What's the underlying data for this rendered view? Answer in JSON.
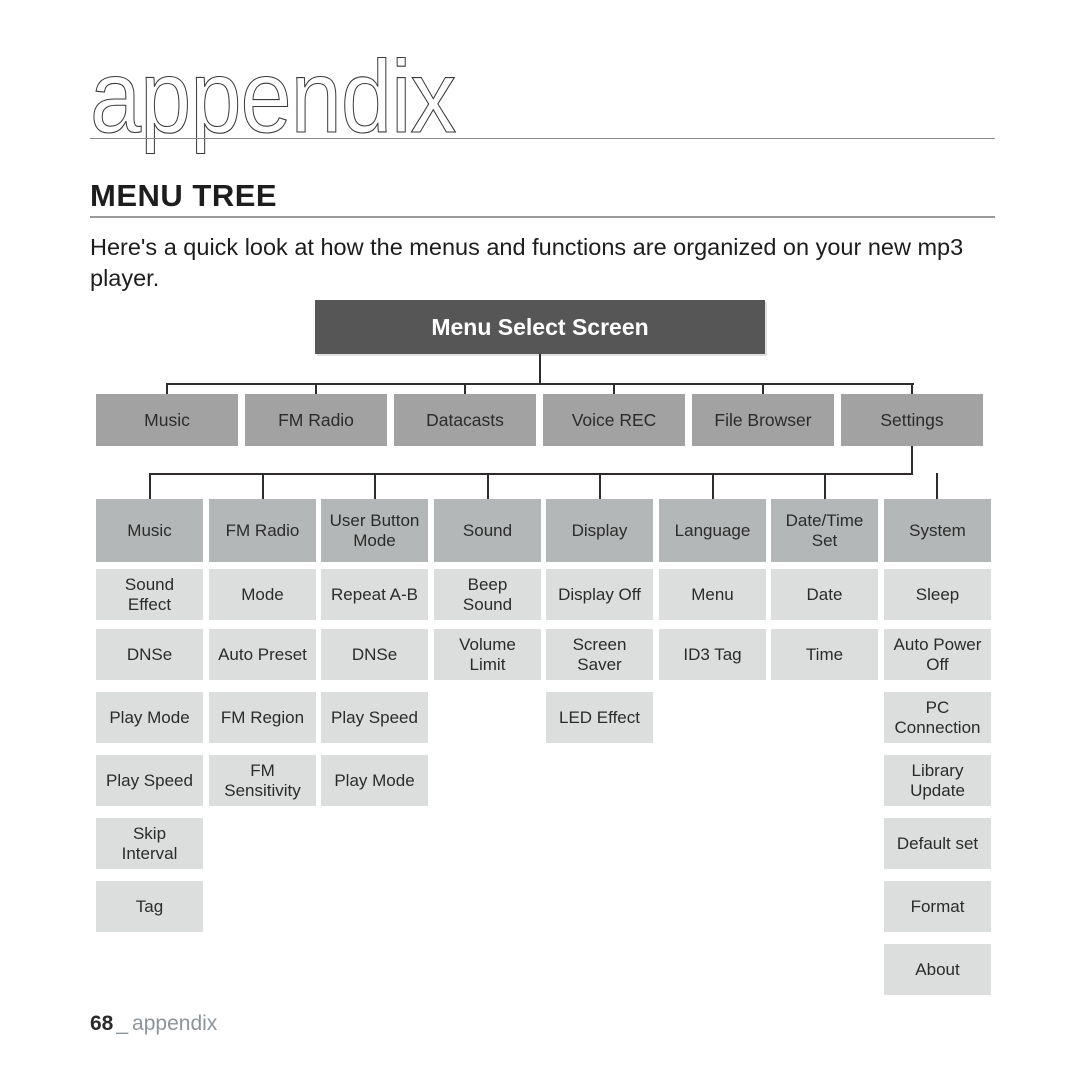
{
  "header": {
    "wordmark": "appendix",
    "section_title": "MENU TREE",
    "intro": "Here's a quick look at how the menus and functions are organized on your new mp3 player."
  },
  "footer": {
    "page_number": "68",
    "separator": "_",
    "label": "appendix"
  },
  "colors": {
    "root_box": "#565656",
    "level1_box": "#a2a2a2",
    "level2_header_box": "#b4b7b7",
    "sub_box": "#dcdddd",
    "connector": "#2f2b2b",
    "text": "#2b2b2b",
    "root_text": "#ffffff"
  },
  "chart_data": {
    "type": "diagram",
    "title": "Menu Select Screen",
    "root": "Menu Select Screen",
    "level1": [
      "Music",
      "FM Radio",
      "Datacasts",
      "Voice REC",
      "File Browser",
      "Settings"
    ],
    "columns": [
      {
        "header": "Music",
        "items": [
          "Sound\nEffect",
          "DNSe",
          "Play Mode",
          "Play Speed",
          "Skip\nInterval",
          "Tag"
        ]
      },
      {
        "header": "FM Radio",
        "items": [
          "Mode",
          "Auto Preset",
          "FM Region",
          "FM\nSensitivity"
        ]
      },
      {
        "header": "User Button\nMode",
        "items": [
          "Repeat A-B",
          "DNSe",
          "Play Speed",
          "Play Mode"
        ]
      },
      {
        "header": "Sound",
        "items": [
          "Beep\nSound",
          "Volume\nLimit"
        ]
      },
      {
        "header": "Display",
        "items": [
          "Display Off",
          "Screen\nSaver",
          "LED Effect"
        ]
      },
      {
        "header": "Language",
        "items": [
          "Menu",
          "ID3 Tag"
        ]
      },
      {
        "header": "Date/Time\nSet",
        "items": [
          "Date",
          "Time"
        ]
      },
      {
        "header": "System",
        "items": [
          "Sleep",
          "Auto Power\nOff",
          "PC\nConnection",
          "Library\nUpdate",
          "Default set",
          "Format",
          "About"
        ]
      }
    ]
  }
}
